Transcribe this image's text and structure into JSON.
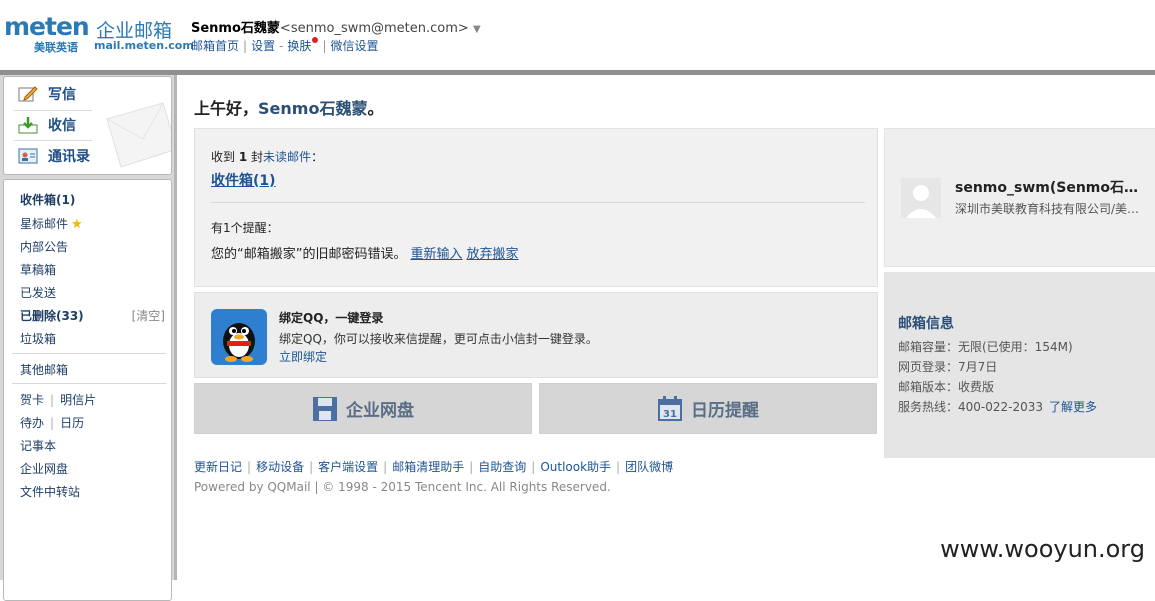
{
  "brand": {
    "logo_en": "meten",
    "logo_cn": "企业邮箱",
    "sub_cn": "美联英语",
    "sub_domain": "mail.meten.com"
  },
  "header": {
    "user_name": "Senmo石魏蒙",
    "user_email": "<senmo_swm@meten.com>",
    "dropdown_glyph": "▼",
    "nav": {
      "home": "邮箱首页",
      "settings": "设置",
      "skin": "换肤",
      "wechat": "微信设置"
    }
  },
  "sidebar": {
    "compose": "写信",
    "receive": "收信",
    "contacts": "通讯录",
    "inbox": "收件箱(1)",
    "starred": "星标邮件",
    "announcement": "内部公告",
    "drafts": "草稿箱",
    "sent": "已发送",
    "deleted": "已删除(33)",
    "clear": "[清空]",
    "spam": "垃圾箱",
    "other": "其他邮箱",
    "greeting_card": "贺卡",
    "postcard": "明信片",
    "todo": "待办",
    "calendar": "日历",
    "notes": "记事本",
    "netdisk": "企业网盘",
    "transfer": "文件中转站"
  },
  "main": {
    "greeting_prefix": "上午好，",
    "greeting_name": "Senmo石魏蒙",
    "greeting_suffix": "。",
    "recv_prefix": "收到",
    "recv_count": "1",
    "recv_mid": "封",
    "recv_unread": "未读邮件",
    "recv_colon": "：",
    "inbox_link": "收件箱(1)",
    "remind_title": "有1个提醒：",
    "remind_msg": "您的“邮箱搬家”的旧邮密码错误。",
    "remind_reenter": "重新输入",
    "remind_abandon": "放弃搬家",
    "qq_title": "绑定QQ，一键登录",
    "qq_desc": "绑定QQ，你可以接收来信提醒，更可点击小信封一键登录。",
    "qq_link": "立即绑定",
    "btn_netdisk": "企业网盘",
    "btn_calendar": "日历提醒",
    "calendar_icon_num": "31"
  },
  "footer": {
    "links": [
      "更新日记",
      "移动设备",
      "客户端设置",
      "邮箱清理助手",
      "自助查询",
      "Outlook助手",
      "团队微博"
    ],
    "copyright": "Powered by QQMail  | © 1998 - 2015 Tencent Inc. All Rights Reserved."
  },
  "profile": {
    "name": "senmo_swm(Senmo石魏蒙)",
    "org": "深圳市美联教育科技有限公司/美联英语"
  },
  "mailbox_info": {
    "title": "邮箱信息",
    "capacity": "邮箱容量：无限(已使用：154M)",
    "web_login": "网页登录：7月7日",
    "version": "邮箱版本：收费版",
    "hotline": "服务热线：400-022-2033",
    "more": "了解更多"
  },
  "watermark": "www.wooyun.org",
  "colors": {
    "brand_blue": "#2a7ab5",
    "link": "#1e5494",
    "button_text": "#5a6f87"
  }
}
